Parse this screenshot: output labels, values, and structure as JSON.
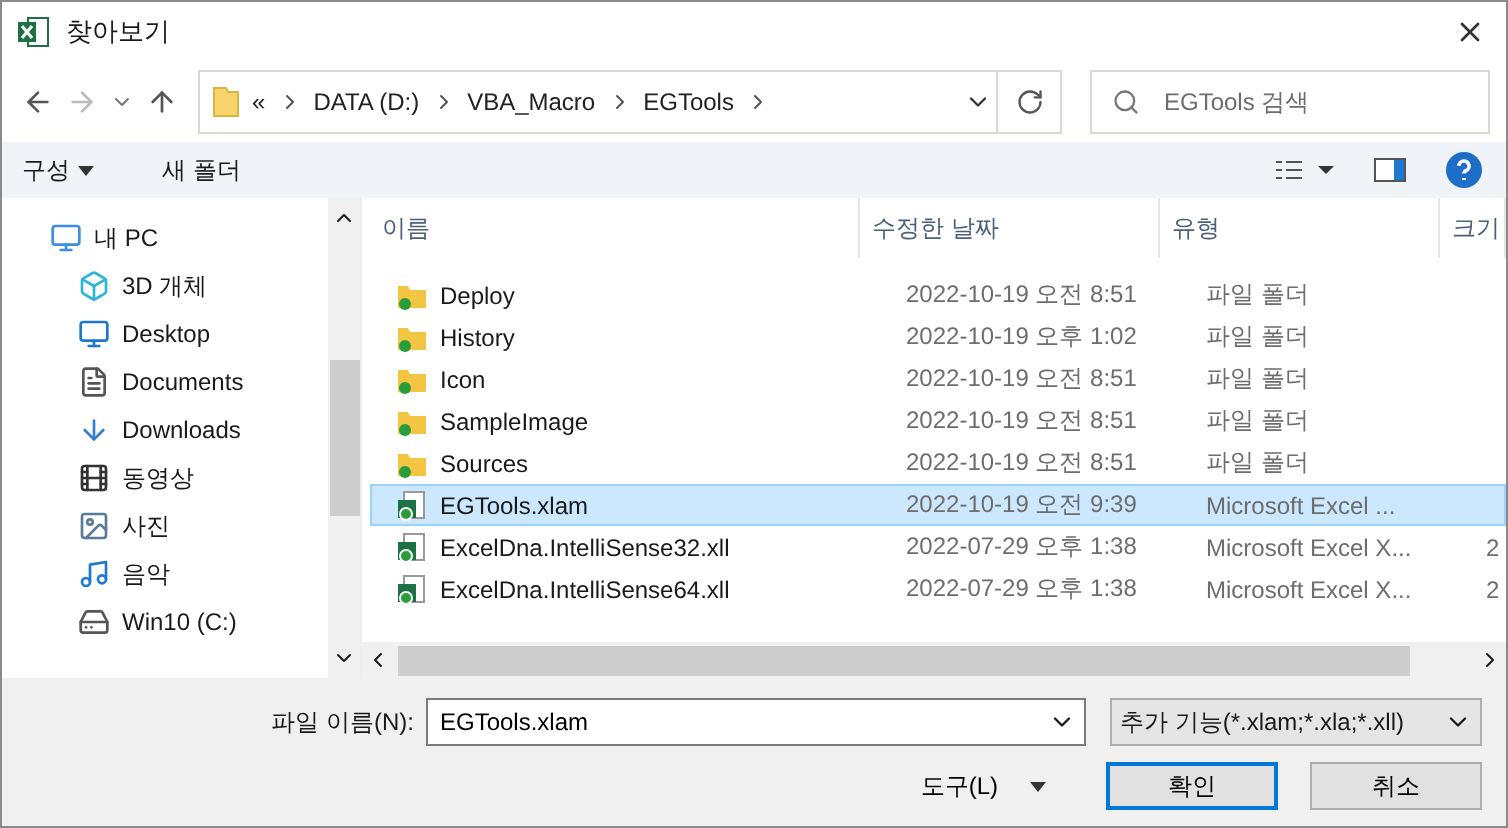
{
  "window": {
    "title": "찾아보기"
  },
  "address": {
    "crumbs": [
      "«",
      "DATA (D:)",
      "VBA_Macro",
      "EGTools"
    ]
  },
  "search": {
    "placeholder": "EGTools 검색"
  },
  "commands": [
    {
      "label": "구성",
      "dropdown": true
    },
    {
      "label": "새 폴더",
      "dropdown": false
    }
  ],
  "sidebar": {
    "items": [
      {
        "label": "내 PC",
        "kind": "pc",
        "children": [
          {
            "label": "3D 개체",
            "kind": "cube"
          },
          {
            "label": "Desktop",
            "kind": "desktop"
          },
          {
            "label": "Documents",
            "kind": "document"
          },
          {
            "label": "Downloads",
            "kind": "download"
          },
          {
            "label": "동영상",
            "kind": "video"
          },
          {
            "label": "사진",
            "kind": "picture"
          },
          {
            "label": "음악",
            "kind": "music"
          },
          {
            "label": "Win10 (C:)",
            "kind": "drive"
          }
        ]
      }
    ]
  },
  "table": {
    "columns": [
      "이름",
      "수정한 날짜",
      "유형",
      "크기"
    ],
    "rows": [
      {
        "name": "Deploy",
        "date": "2022-10-19 오전 8:51",
        "type": "파일 폴더",
        "kind": "folder",
        "selected": false
      },
      {
        "name": "History",
        "date": "2022-10-19 오후 1:02",
        "type": "파일 폴더",
        "kind": "folder",
        "selected": false
      },
      {
        "name": "Icon",
        "date": "2022-10-19 오전 8:51",
        "type": "파일 폴더",
        "kind": "folder",
        "selected": false
      },
      {
        "name": "SampleImage",
        "date": "2022-10-19 오전 8:51",
        "type": "파일 폴더",
        "kind": "folder",
        "selected": false
      },
      {
        "name": "Sources",
        "date": "2022-10-19 오전 8:51",
        "type": "파일 폴더",
        "kind": "folder",
        "selected": false
      },
      {
        "name": "EGTools.xlam",
        "date": "2022-10-19 오전 9:39",
        "type": "Microsoft Excel ...",
        "size": "",
        "kind": "excel",
        "selected": true
      },
      {
        "name": "ExcelDna.IntelliSense32.xll",
        "date": "2022-07-29 오후 1:38",
        "type": "Microsoft Excel X...",
        "size": "2",
        "kind": "excel",
        "selected": false
      },
      {
        "name": "ExcelDna.IntelliSense64.xll",
        "date": "2022-07-29 오후 1:38",
        "type": "Microsoft Excel X...",
        "size": "2",
        "kind": "excel",
        "selected": false
      }
    ]
  },
  "footer": {
    "filename_label": "파일 이름(N):",
    "filename": "EGTools.xlam",
    "filter": "추가 기능(*.xlam;*.xla;*.xll)",
    "tools": "도구(L)",
    "buttons": [
      "확인",
      "취소"
    ]
  }
}
